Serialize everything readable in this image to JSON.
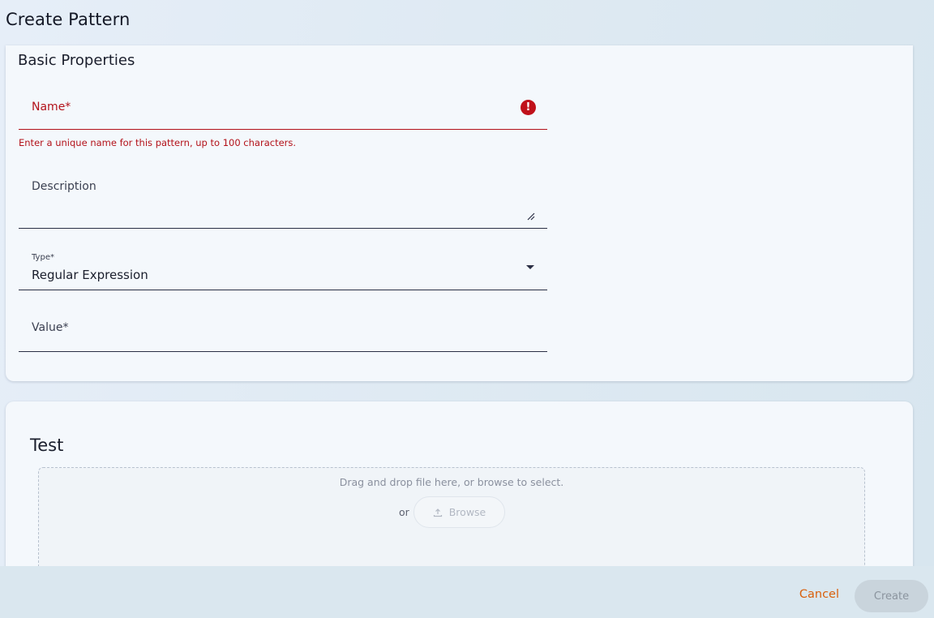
{
  "page": {
    "title": "Create Pattern"
  },
  "basic": {
    "section_title": "Basic Properties",
    "name": {
      "label": "Name*",
      "error": "Enter a unique name for this pattern, up to 100 characters.",
      "error_icon": "!"
    },
    "description": {
      "label": "Description"
    },
    "type": {
      "label": "Type*",
      "value": "Regular Expression"
    },
    "value": {
      "label": "Value*"
    }
  },
  "test": {
    "section_title": "Test",
    "dropzone_text": "Drag and drop file here, or browse to select.",
    "or_text": "or",
    "browse_label": "Browse"
  },
  "footer": {
    "cancel_label": "Cancel",
    "create_label": "Create"
  },
  "colors": {
    "error": "#b3121a",
    "accent": "#d9600c",
    "disabled": "#c9d4dc"
  }
}
